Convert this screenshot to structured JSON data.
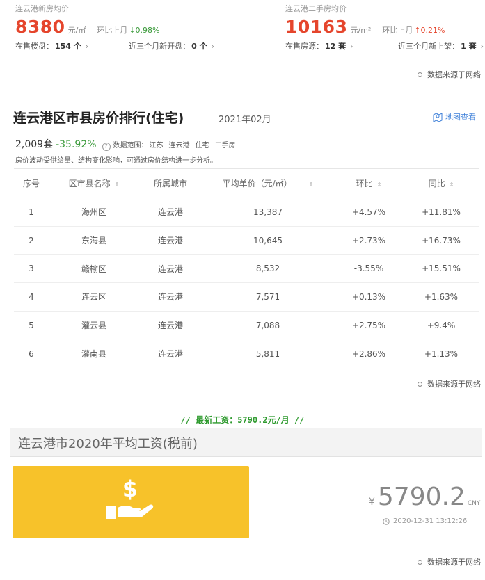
{
  "new_house": {
    "title": "连云港新房均价",
    "price": "8380",
    "unit": "元/㎡",
    "ratio_label": "环比上月",
    "ratio": "↓0.98%",
    "on_sale_label": "在售楼盘：",
    "on_sale_value": "154 个",
    "new_open_label": "近三个月新开盘：",
    "new_open_value": "0 个"
  },
  "second_hand": {
    "title": "连云港二手房均价",
    "price": "10163",
    "unit": "元/m²",
    "ratio_label": "环比上月",
    "ratio": "↑0.21%",
    "on_sale_label": "在售房源：",
    "on_sale_value": "12 套",
    "new_list_label": "近三个月新上架：",
    "new_list_value": "1 套"
  },
  "source_text": "数据来源于网络",
  "ranking": {
    "title": "连云港区市县房价排行(住宅)",
    "date": "2021年02月",
    "map_link": "地图查看",
    "count": "2,009套",
    "change": "-35.92%",
    "scope_label": "数据范围：",
    "scope_items": [
      "江苏",
      "连云港",
      "住宅",
      "二手房"
    ],
    "note": "房价波动受供给量、结构变化影响，可通过房价结构进一步分析。",
    "columns": [
      "序号",
      "区市县名称",
      "所属城市",
      "平均单价（元/㎡）",
      "环比",
      "同比"
    ],
    "rows": [
      {
        "idx": "1",
        "name": "海州区",
        "city": "连云港",
        "price": "13,387",
        "hb": "+4.57%",
        "tb": "+11.81%"
      },
      {
        "idx": "2",
        "name": "东海县",
        "city": "连云港",
        "price": "10,645",
        "hb": "+2.73%",
        "tb": "+16.73%"
      },
      {
        "idx": "3",
        "name": "赣榆区",
        "city": "连云港",
        "price": "8,532",
        "hb": "-3.55%",
        "tb": "+15.51%"
      },
      {
        "idx": "4",
        "name": "连云区",
        "city": "连云港",
        "price": "7,571",
        "hb": "+0.13%",
        "tb": "+1.63%"
      },
      {
        "idx": "5",
        "name": "灌云县",
        "city": "连云港",
        "price": "7,088",
        "hb": "+2.75%",
        "tb": "+9.4%"
      },
      {
        "idx": "6",
        "name": "灌南县",
        "city": "连云港",
        "price": "5,811",
        "hb": "+2.86%",
        "tb": "+1.13%"
      }
    ]
  },
  "salary": {
    "headline": "// 最新工资：5790.2元/月 //",
    "title": "连云港市2020年平均工资(税前)",
    "currency": "¥",
    "value": "5790.2",
    "unit": "CNY",
    "time": "2020-12-31 13:12:26"
  },
  "colors": {
    "price_red": "#e5452c",
    "down_green": "#3a9a3a",
    "link_blue": "#3b7ed8",
    "card_yellow": "#f7c22a"
  },
  "icons": [
    "chevron-right-icon",
    "source-dot-icon",
    "map-pin-icon",
    "question-icon",
    "sort-icon",
    "money-hand-icon",
    "clock-icon"
  ]
}
